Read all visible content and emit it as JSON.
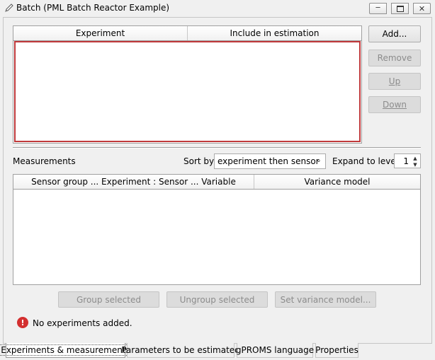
{
  "window": {
    "title": "Batch  (PML Batch Reactor Example)",
    "icon": "pencil-icon",
    "controls": {
      "minimize": "minimize-icon",
      "maximize": "maximize-icon",
      "close": "close-icon"
    }
  },
  "experiments": {
    "columns": [
      "Experiment",
      "Include in estimation"
    ],
    "rows": [],
    "buttons": {
      "add": {
        "label": "Add...",
        "enabled": true
      },
      "remove": {
        "label": "Remove",
        "enabled": false
      },
      "up": {
        "label": "Up",
        "enabled": false
      },
      "down": {
        "label": "Down",
        "enabled": false
      }
    }
  },
  "measurements": {
    "label": "Measurements",
    "sort_label": "Sort by:",
    "sort_value": "experiment then sensor",
    "expand_label": "Expand to level:",
    "expand_value": "1",
    "columns": [
      "Sensor group ... Experiment : Sensor ... Variable",
      "Variance model"
    ],
    "rows": [],
    "buttons": {
      "group": {
        "label": "Group selected",
        "enabled": false
      },
      "ungroup": {
        "label": "Ungroup selected",
        "enabled": false
      },
      "variance": {
        "label": "Set variance model...",
        "enabled": false
      }
    }
  },
  "status": {
    "icon": "error-icon",
    "message": "No experiments added."
  },
  "tabs": [
    {
      "label": "Experiments & measurements",
      "active": true
    },
    {
      "label": "Parameters to be estimated",
      "active": false
    },
    {
      "label": "gPROMS language",
      "active": false
    },
    {
      "label": "Properties",
      "active": false
    }
  ],
  "colors": {
    "invalid_border": "#c0393b",
    "error_icon": "#d32f2f",
    "disabled_text": "#8c8c8c"
  }
}
